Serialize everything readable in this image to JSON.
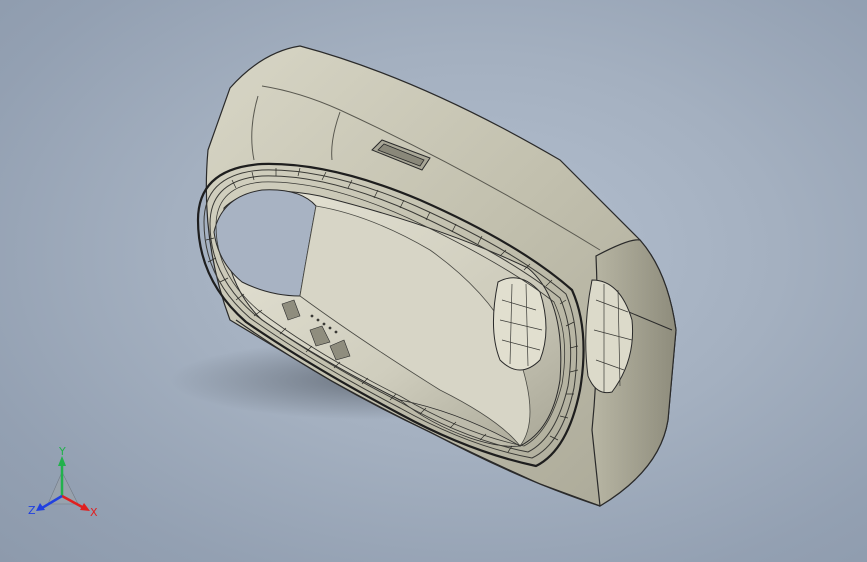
{
  "viewport": {
    "background_colors": [
      "#b3bfcf",
      "#8d9aac"
    ],
    "model": {
      "shell_color": "#c5c3b2",
      "shell_shadow_color": "#8f8d7e",
      "edge_color": "#2a2a2a",
      "display_style": "shaded-with-edges"
    }
  },
  "triad": {
    "x_label": "X",
    "y_label": "Y",
    "z_label": "Z",
    "x_color": "#e02020",
    "y_color": "#22b14c",
    "z_color": "#2040e0"
  }
}
